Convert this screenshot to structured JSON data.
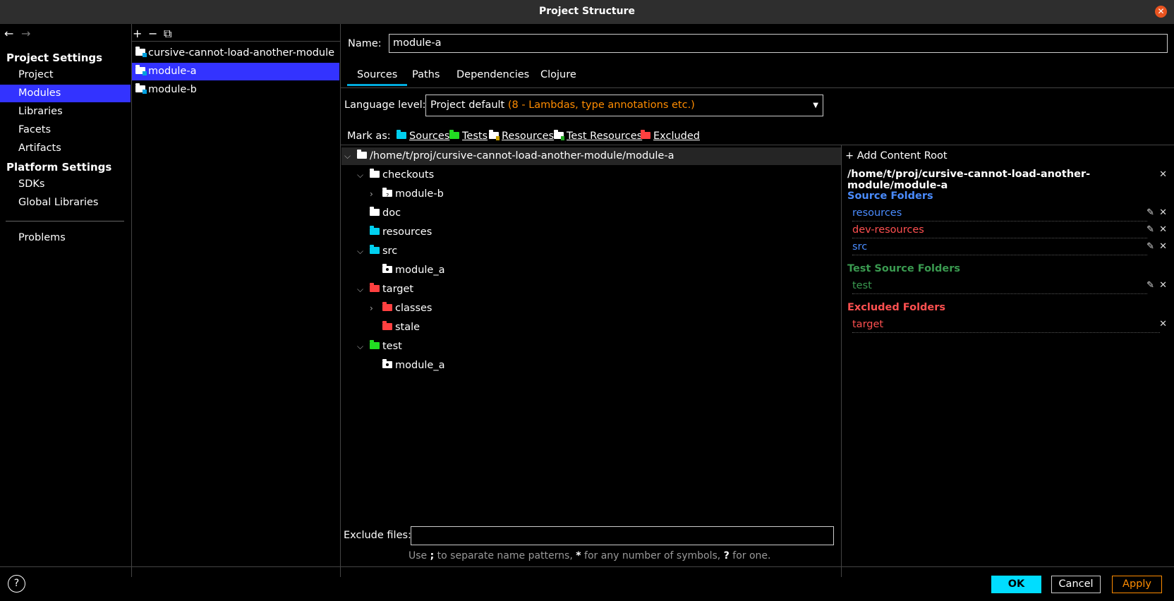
{
  "window": {
    "title": "Project Structure"
  },
  "nav": {
    "back": "←",
    "forward": "→",
    "project_settings": "Project Settings",
    "platform_settings": "Platform Settings",
    "items": {
      "project": "Project",
      "modules": "Modules",
      "libraries": "Libraries",
      "facets": "Facets",
      "artifacts": "Artifacts",
      "sdks": "SDKs",
      "global_libraries": "Global Libraries",
      "problems": "Problems"
    }
  },
  "module_list": {
    "tools": {
      "add": "+",
      "remove": "−",
      "copy": "⧉"
    },
    "items": [
      "cursive-cannot-load-another-module",
      "module-a",
      "module-b"
    ],
    "selected": "module-a"
  },
  "module": {
    "name_label": "Name:",
    "name_value": "module-a",
    "tabs": [
      "Sources",
      "Paths",
      "Dependencies",
      "Clojure"
    ],
    "active_tab": "Sources",
    "language_level_label": "Language level:",
    "language_level_value": "Project default",
    "language_level_hint": "(8 - Lambdas, type annotations etc.)",
    "mark_as_label": "Mark as:",
    "mark_as": [
      "Sources",
      "Tests",
      "Resources",
      "Test Resources",
      "Excluded"
    ]
  },
  "tree": {
    "root": "/home/t/proj/cursive-cannot-load-another-module/module-a",
    "nodes": {
      "checkouts": "checkouts",
      "module_b": "module-b",
      "doc": "doc",
      "resources": "resources",
      "src": "src",
      "src_module_a": "module_a",
      "target": "target",
      "classes": "classes",
      "stale": "stale",
      "test": "test",
      "test_module_a": "module_a"
    }
  },
  "exclude": {
    "label": "Exclude files:",
    "value": "",
    "hint_1": "Use ",
    "hint_sep": ";",
    "hint_2": " to separate name patterns, ",
    "hint_star": "*",
    "hint_3": " for any number of symbols, ",
    "hint_q": "?",
    "hint_4": " for one."
  },
  "content_root": {
    "add_label": "Add Content Root",
    "path": "/home/t/proj/cursive-cannot-load-another-module/module-a",
    "source_folders_heading": "Source Folders",
    "source_folders": [
      "resources",
      "dev-resources",
      "src"
    ],
    "test_source_folders_heading": "Test Source Folders",
    "test_source_folders": [
      "test"
    ],
    "excluded_folders_heading": "Excluded Folders",
    "excluded_folders": [
      "target"
    ]
  },
  "footer": {
    "help": "?",
    "ok": "OK",
    "cancel": "Cancel",
    "apply": "Apply"
  },
  "colors": {
    "selection": "#3333ff",
    "source_folder": "#00d0f0",
    "test_folder": "#22dd22",
    "excluded_folder": "#ff4040",
    "hint_orange": "#ff8c00",
    "ok_button": "#00ddff"
  }
}
